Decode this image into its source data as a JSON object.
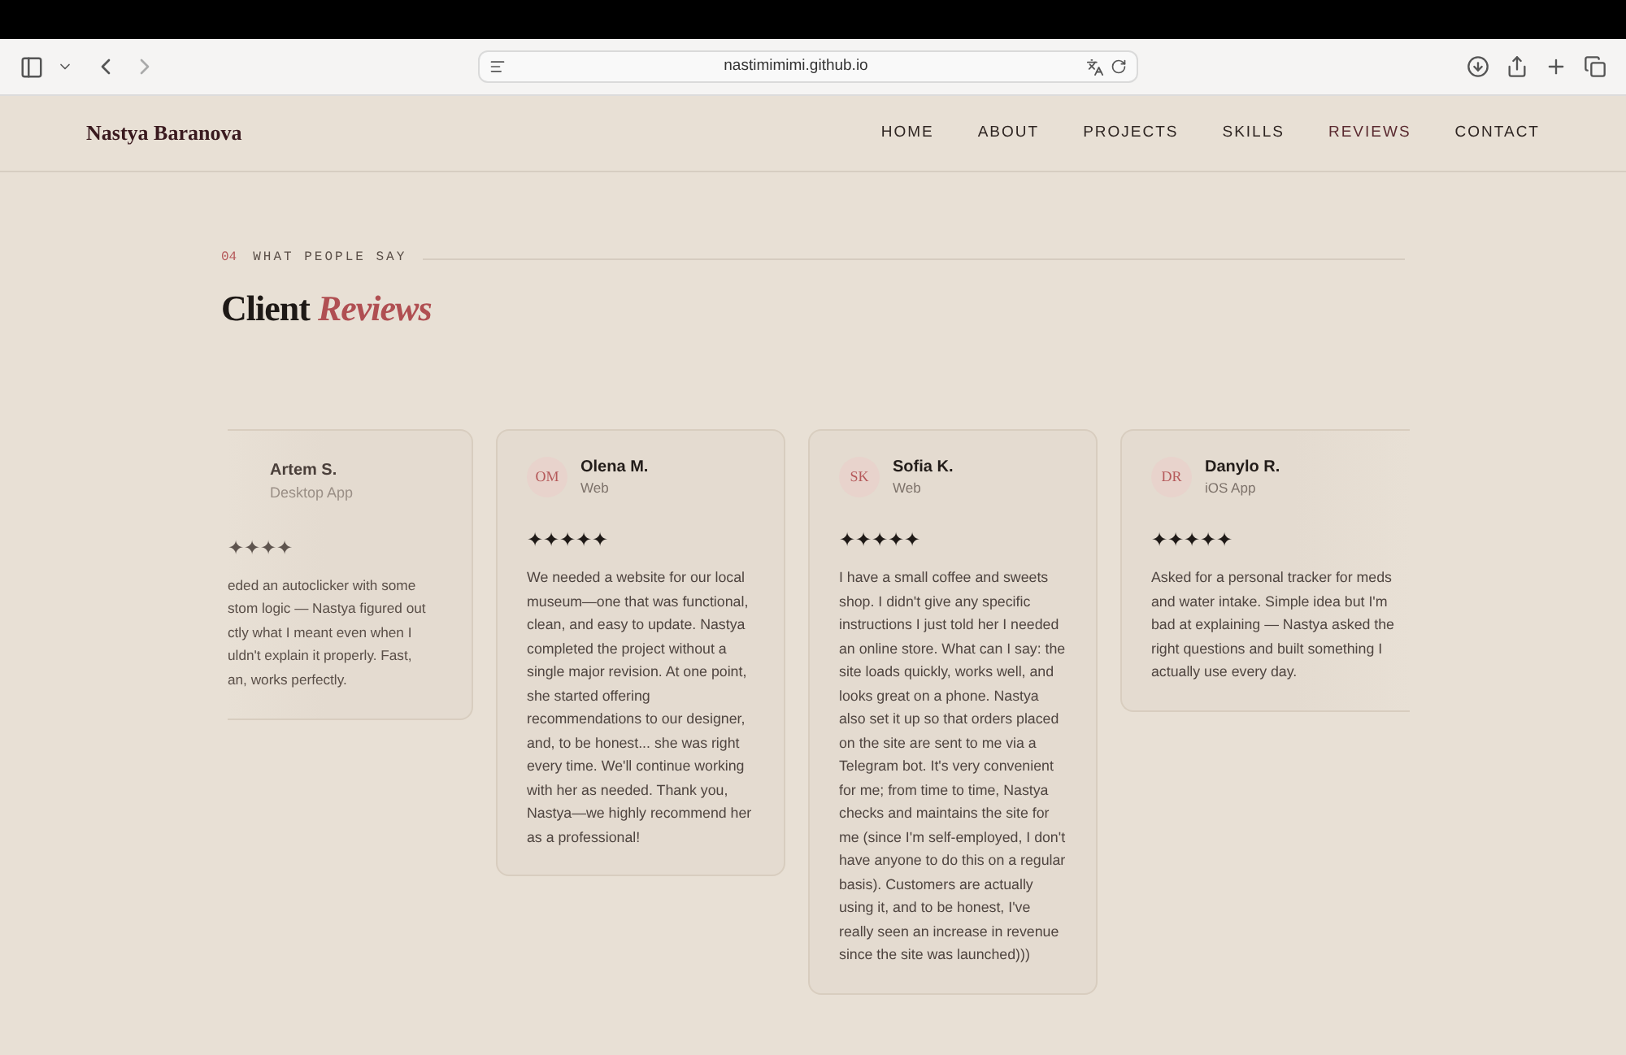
{
  "browser": {
    "url": "nastimimimi.github.io"
  },
  "site": {
    "brand": "Nastya Baranova",
    "nav": [
      {
        "label": "HOME",
        "selected": false
      },
      {
        "label": "ABOUT",
        "selected": false
      },
      {
        "label": "PROJECTS",
        "selected": false
      },
      {
        "label": "SKILLS",
        "selected": false
      },
      {
        "label": "REVIEWS",
        "selected": true
      },
      {
        "label": "CONTACT",
        "selected": false
      }
    ]
  },
  "section": {
    "number": "04",
    "eyebrow": "WHAT PEOPLE SAY",
    "title": "Client",
    "title_accent": "Reviews"
  },
  "reviews": [
    {
      "kind": "cut-left",
      "name": "Artem S.",
      "project": "Desktop App",
      "star_glyph": "✦",
      "stars": 4,
      "lines": [
        "eded an autoclicker with some",
        "stom logic — Nastya figured out",
        "ctly what I meant even when I",
        "uldn't explain it properly. Fast,",
        "an, works perfectly."
      ]
    },
    {
      "kind": "full",
      "initials": "OM",
      "name": "Olena M.",
      "project": "Web",
      "star_glyph": "✦",
      "stars": 5,
      "text": "We needed a website for our local museum—one that was functional, clean, and easy to update. Nastya completed the project without a single major revision. At one point, she started offering recommendations to our designer, and, to be honest... she was right every time. We'll continue working with her as needed. Thank you, Nastya—we highly recommend her as a professional!"
    },
    {
      "kind": "full",
      "initials": "SK",
      "name": "Sofia K.",
      "project": "Web",
      "star_glyph": "✦",
      "stars": 5,
      "text": "I have a small coffee and sweets shop. I didn't give any specific instructions I just told her I needed an online store. What can I say: the site loads quickly, works well, and looks great on a phone. Nastya also set it up so that orders placed on the site are sent to me via a Telegram bot. It's very convenient for me; from time to time, Nastya checks and maintains the site for me (since I'm self-employed, I don't have anyone to do this on a regular basis). Customers are actually using it, and to be honest, I've really seen an increase in revenue since the site was launched)))"
    },
    {
      "kind": "fade-right",
      "initials": "DR",
      "name": "Danylo R.",
      "project": "iOS App",
      "star_glyph": "✦",
      "stars": 5,
      "text": "Asked for a personal tracker for meds and water intake. Simple idea but I'm bad at explaining — Nastya asked the right questions and built something I actually use every day."
    }
  ]
}
